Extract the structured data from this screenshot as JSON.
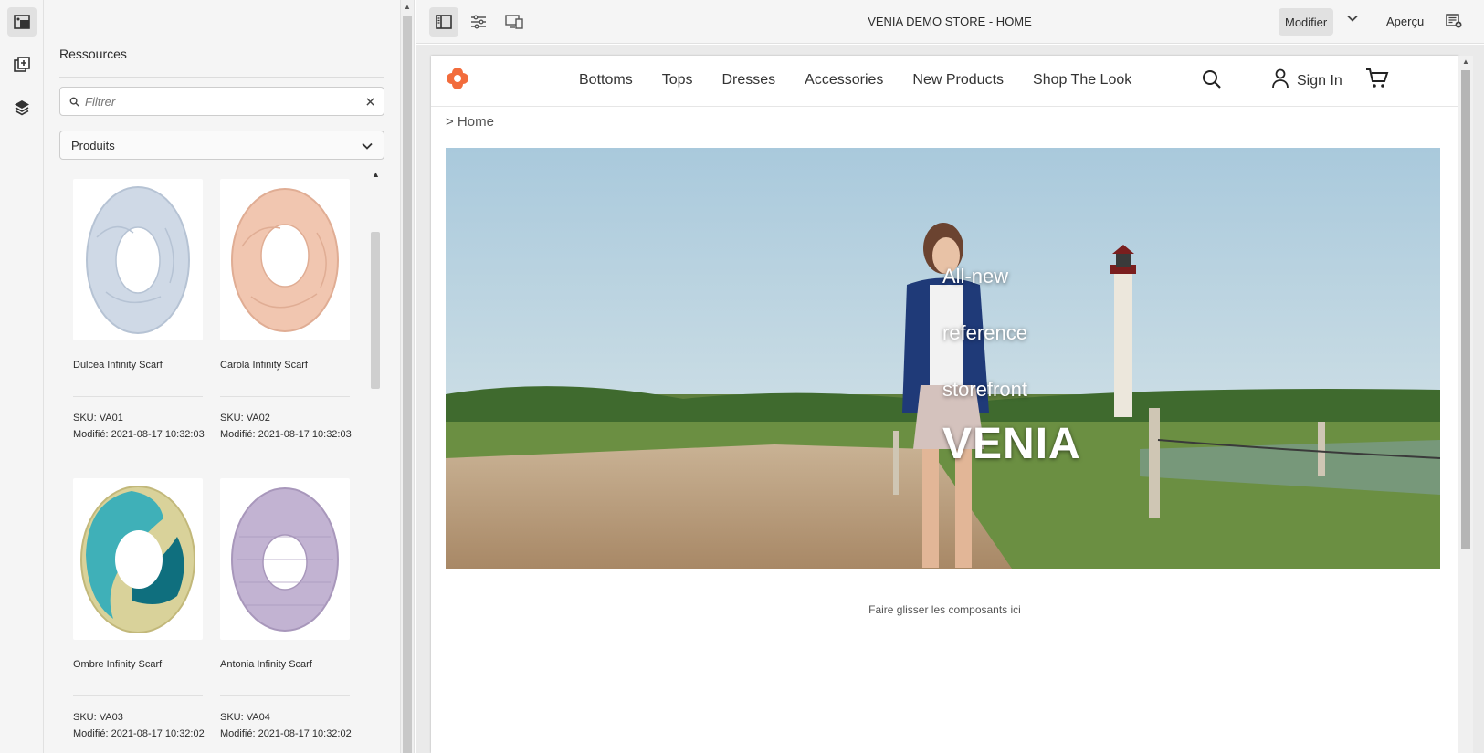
{
  "editor": {
    "page_title": "VENIA DEMO STORE - HOME",
    "mode_label": "Modifier",
    "preview_label": "Aperçu"
  },
  "panel": {
    "title": "Ressources",
    "filter_placeholder": "Filtrer",
    "type_selected": "Produits",
    "products": [
      {
        "name": "Dulcea Infinity Scarf",
        "sku": "SKU: VA01",
        "modified": "Modifié: 2021-08-17 10:32:03",
        "color": "#cfd9e6"
      },
      {
        "name": "Carola Infinity Scarf",
        "sku": "SKU: VA02",
        "modified": "Modifié: 2021-08-17 10:32:03",
        "color": "#f1c6b0"
      },
      {
        "name": "Ombre Infinity Scarf",
        "sku": "SKU: VA03",
        "modified": "Modifié: 2021-08-17 10:32:02",
        "color": "#1d8c9b"
      },
      {
        "name": "Antonia Infinity Scarf",
        "sku": "SKU: VA04",
        "modified": "Modifié: 2021-08-17 10:32:02",
        "color": "#c2b3d2"
      }
    ]
  },
  "site": {
    "nav": [
      "Bottoms",
      "Tops",
      "Dresses",
      "Accessories",
      "New Products",
      "Shop The Look"
    ],
    "sign_in": "Sign In",
    "breadcrumb": "> Home",
    "hero_lines": [
      "All-new",
      "reference",
      "storefront"
    ],
    "hero_brand": "VENIA",
    "brand_color": "#f26c3c"
  },
  "dropzone_text": "Faire glisser les composants ici"
}
